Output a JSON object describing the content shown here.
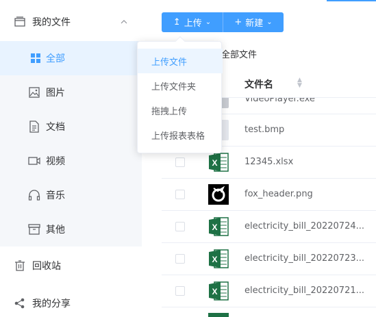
{
  "sidebar": {
    "my_files": "我的文件",
    "items": [
      {
        "label": "全部",
        "icon": "grid-icon"
      },
      {
        "label": "图片",
        "icon": "image-icon"
      },
      {
        "label": "文档",
        "icon": "document-icon"
      },
      {
        "label": "视频",
        "icon": "video-icon"
      },
      {
        "label": "音乐",
        "icon": "headphones-icon"
      },
      {
        "label": "其他",
        "icon": "archive-icon"
      }
    ],
    "recycle": "回收站",
    "share": "我的分享",
    "collapse_glyph": "«"
  },
  "toolbar": {
    "upload_label": "上传",
    "new_label": "新建",
    "upload_glyph": "↥",
    "new_glyph": "+",
    "caret": "⌄"
  },
  "breadcrumb": "全部文件",
  "table": {
    "header_name": "文件名",
    "rows": [
      {
        "name": "VideoPlayer.exe",
        "type": "exe"
      },
      {
        "name": "test.bmp",
        "type": "bmp"
      },
      {
        "name": "12345.xlsx",
        "type": "xlsx"
      },
      {
        "name": "fox_header.png",
        "type": "png"
      },
      {
        "name": "electricity_bill_20220724....",
        "type": "xlsx"
      },
      {
        "name": "electricity_bill_20220723....",
        "type": "xlsx"
      },
      {
        "name": "electricity_bill_20220721....",
        "type": "xlsx"
      }
    ]
  },
  "upload_menu": {
    "items": [
      "上传文件",
      "上传文件夹",
      "拖拽上传",
      "上传报表表格"
    ],
    "hovered_index": 0
  },
  "colors": {
    "accent": "#409eff",
    "excel_green": "#1e7145"
  }
}
